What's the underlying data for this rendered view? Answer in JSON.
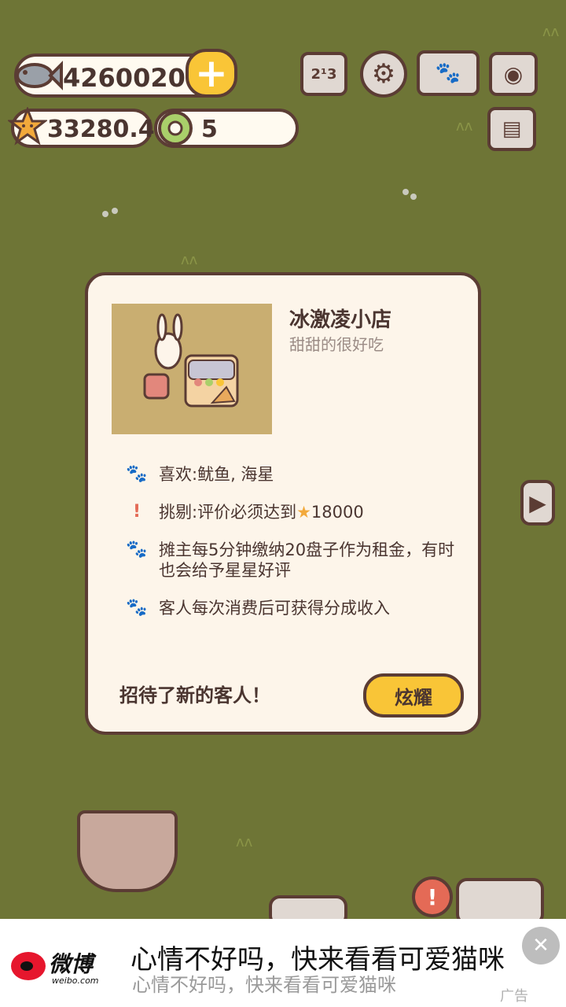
{
  "hud": {
    "fish_count": "4260020",
    "star_rating": "33280.4",
    "ring_count": "5",
    "add_label": "+",
    "icons": [
      "ranking-icon",
      "settings-gear-icon",
      "cat-book-icon",
      "camera-icon",
      "newspaper-icon"
    ]
  },
  "dialog": {
    "title": "冰激凌小店",
    "subtitle": "甜甜的很好吃",
    "traits": [
      {
        "icon": "paw-icon",
        "text": "喜欢:鱿鱼, 海星"
      },
      {
        "icon": "exclamation-icon",
        "text_before": "挑剔:评价必须达到",
        "star": "★",
        "text_after": "18000"
      },
      {
        "icon": "paw-icon",
        "text": "摊主每5分钟缴纳20盘子作为租金，有时也会给予星星好评"
      },
      {
        "icon": "paw-icon",
        "text": "客人每次消费后可获得分成收入"
      }
    ],
    "footer_text": "招待了新的客人！",
    "show_button": "炫耀"
  },
  "ad": {
    "brand": "微博",
    "domain": "weibo.com",
    "title": "心情不好吗，快来看看可爱猫咪",
    "subtitle": "心情不好吗，快来看看可爱猫咪",
    "tag": "广告",
    "close": "✕"
  },
  "colors": {
    "grass": "#6e7536",
    "panel": "#fdf5ea",
    "outline": "#5b3c34",
    "button": "#f9c537",
    "accent_red": "#e46a56"
  }
}
